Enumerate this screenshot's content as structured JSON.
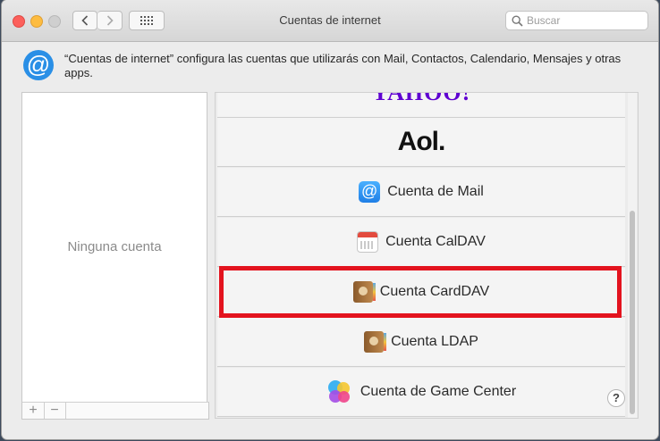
{
  "window": {
    "title": "Cuentas de internet",
    "search_placeholder": "Buscar"
  },
  "header": {
    "icon": "at-sign-icon",
    "description": "“Cuentas de internet” configura las cuentas que utilizarás con Mail, Contactos, Calendario, Mensajes y otras apps."
  },
  "accounts_list": {
    "empty_label": "Ninguna cuenta",
    "add_label": "+",
    "remove_label": "−"
  },
  "providers": [
    {
      "id": "yahoo",
      "label": "YAHOO!",
      "icon": "yahoo-logo"
    },
    {
      "id": "aol",
      "label": "Aol.",
      "icon": "aol-logo"
    },
    {
      "id": "mail",
      "label": "Cuenta de Mail",
      "icon": "mail-at-icon"
    },
    {
      "id": "caldav",
      "label": "Cuenta CalDAV",
      "icon": "calendar-icon"
    },
    {
      "id": "carddav",
      "label": "Cuenta CardDAV",
      "icon": "address-book-icon"
    },
    {
      "id": "ldap",
      "label": "Cuenta LDAP",
      "icon": "address-book-icon"
    },
    {
      "id": "gamecenter",
      "label": "Cuenta de Game Center",
      "icon": "game-center-icon"
    }
  ],
  "help_label": "?",
  "colors": {
    "highlight": "#e3131e",
    "yahoo": "#5f01d1",
    "accent": "#2a8fe6"
  }
}
